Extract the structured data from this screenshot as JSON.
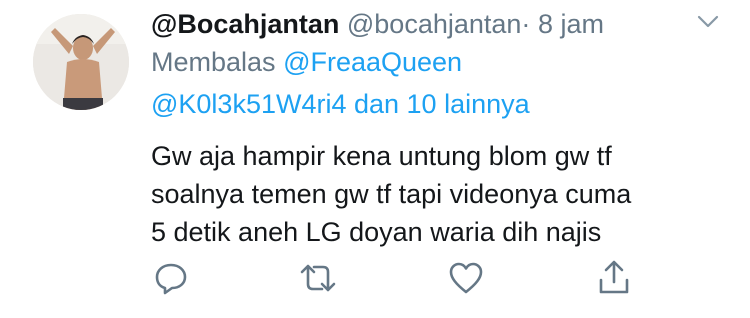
{
  "tweet": {
    "display_name": "@Bocahjantan",
    "handle": "@bocahjantan",
    "separator": "·",
    "time": "8 jam",
    "reply_prefix": "Membalas",
    "reply_to": "@FreaaQueen",
    "reply_others": "@K0l3k51W4ri4 dan 10 lainnya",
    "body_lines": [
      "Gw aja hampir kena untung blom gw tf",
      "soalnya temen gw tf tapi videonya cuma",
      "5 detik aneh LG doyan waria dih najis"
    ]
  },
  "icons": {
    "menu": "chevron-down-icon",
    "reply": "reply-icon",
    "retweet": "retweet-icon",
    "like": "heart-icon",
    "share": "share-icon"
  },
  "colors": {
    "text": "#14171a",
    "muted": "#657786",
    "link": "#1da1f2",
    "icon": "#657786"
  }
}
